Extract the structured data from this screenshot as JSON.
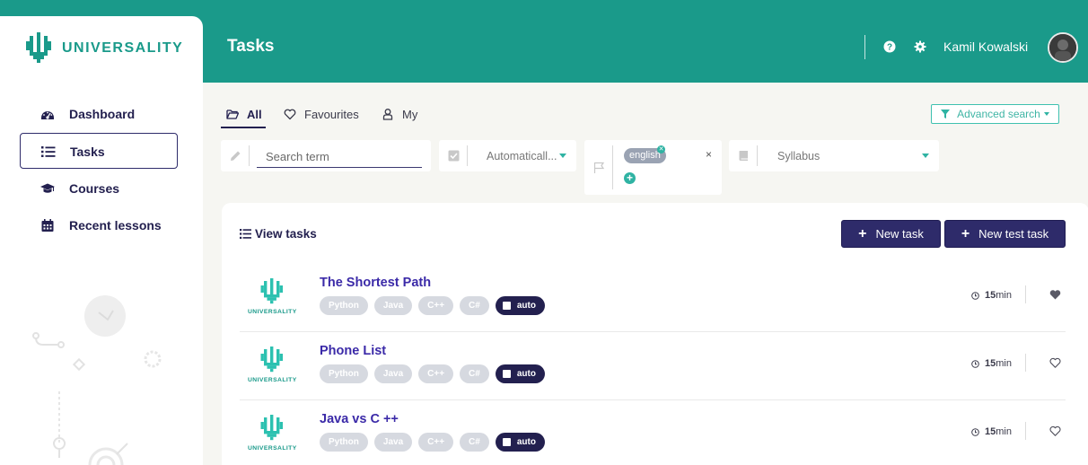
{
  "app": {
    "brand": "UNIVERSALITY",
    "brand_color": "#1a9a8a",
    "accent_dark": "#23204f"
  },
  "header": {
    "title": "Tasks",
    "user_name": "Kamil Kowalski",
    "icons": [
      "help-icon",
      "gear-icon"
    ]
  },
  "sidebar": {
    "items": [
      {
        "label": "Dashboard",
        "icon": "dashboard-icon",
        "active": false
      },
      {
        "label": "Tasks",
        "icon": "list-icon",
        "active": true
      },
      {
        "label": "Courses",
        "icon": "graduation-cap-icon",
        "active": false
      },
      {
        "label": "Recent lessons",
        "icon": "calendar-icon",
        "active": false
      }
    ]
  },
  "tabs": [
    {
      "label": "All",
      "icon": "folder-open-icon",
      "active": true
    },
    {
      "label": "Favourites",
      "icon": "heart-outline-icon",
      "active": false
    },
    {
      "label": "My",
      "icon": "user-icon",
      "active": false
    }
  ],
  "advanced_search": {
    "label": "Advanced search"
  },
  "filters": {
    "search_placeholder": "Search term",
    "auto_value": "Automaticall...",
    "language_chip": "english",
    "language_clear": "×",
    "add_language": "+",
    "syllabus_value": "Syllabus"
  },
  "panel": {
    "title": "View tasks",
    "new_task": "New task",
    "new_test_task": "New test task"
  },
  "tasks": [
    {
      "title": "The Shortest Path",
      "logo_label": "UNIVERSALITY",
      "tags": [
        "Python",
        "Java",
        "C++",
        "C#"
      ],
      "auto_label": "auto",
      "duration_value": "15",
      "duration_unit": "min",
      "favourite": true
    },
    {
      "title": "Phone List",
      "logo_label": "UNIVERSALITY",
      "tags": [
        "Python",
        "Java",
        "C++",
        "C#"
      ],
      "auto_label": "auto",
      "duration_value": "15",
      "duration_unit": "min",
      "favourite": false
    },
    {
      "title": "Java vs C ++",
      "logo_label": "UNIVERSALITY",
      "tags": [
        "Python",
        "Java",
        "C++",
        "C#"
      ],
      "auto_label": "auto",
      "duration_value": "15",
      "duration_unit": "min",
      "favourite": false
    }
  ]
}
